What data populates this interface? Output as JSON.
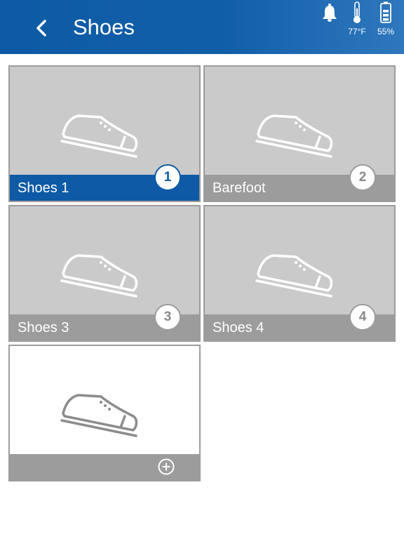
{
  "header": {
    "title": "Shoes",
    "back_icon": "chevron-left-icon",
    "temperature": "77°F",
    "battery": "55%",
    "accent_color": "#0e5aa6"
  },
  "tiles": [
    {
      "label": "Shoes 1",
      "number": "1",
      "selected": true
    },
    {
      "label": "Barefoot",
      "number": "2",
      "selected": false
    },
    {
      "label": "Shoes 3",
      "number": "3",
      "selected": false
    },
    {
      "label": "Shoes 4",
      "number": "4",
      "selected": false
    }
  ],
  "add_tile": {
    "icon": "plus-circle-icon"
  }
}
